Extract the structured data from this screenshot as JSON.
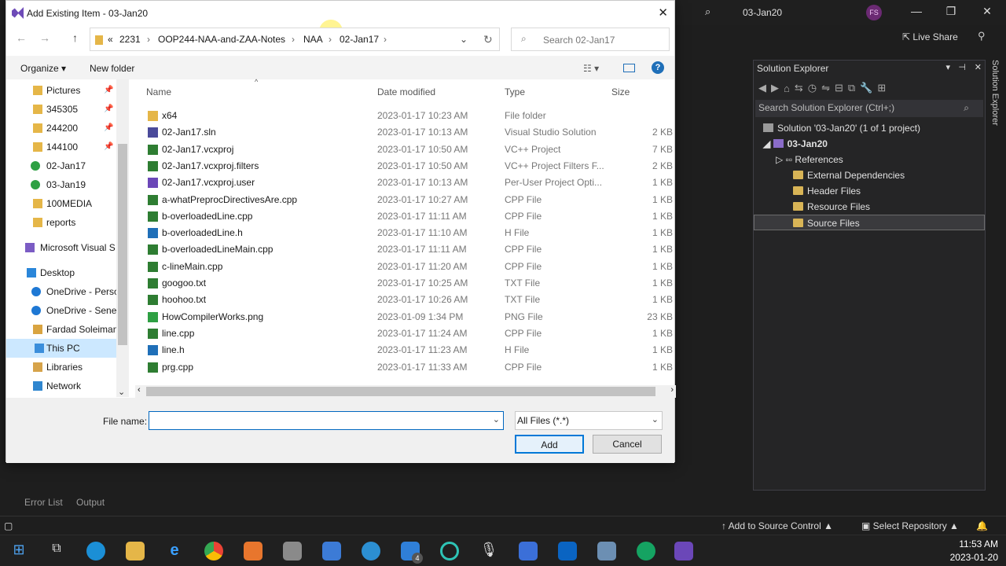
{
  "dialog": {
    "title": "Add Existing Item - 03-Jan20",
    "breadcrumbs": [
      "«",
      "2231",
      "OOP244-NAA-and-ZAA-Notes",
      "NAA",
      "02-Jan17"
    ],
    "search_placeholder": "Search 02-Jan17",
    "organize_label": "Organize ▾",
    "new_folder_label": "New folder",
    "columns": {
      "name": "Name",
      "date": "Date modified",
      "type": "Type",
      "size": "Size"
    },
    "nav_items": [
      {
        "label": "Pictures",
        "pinned": true
      },
      {
        "label": "345305",
        "pinned": true
      },
      {
        "label": "244200",
        "pinned": true
      },
      {
        "label": "144100",
        "pinned": true
      },
      {
        "label": "02-Jan17",
        "pinned": false
      },
      {
        "label": "03-Jan19",
        "pinned": false
      },
      {
        "label": "100MEDIA",
        "pinned": false
      },
      {
        "label": "reports",
        "pinned": false
      },
      {
        "label": "Microsoft Visual S",
        "pinned": false
      },
      {
        "label": "Desktop",
        "pinned": false
      },
      {
        "label": "OneDrive - Perso",
        "pinned": false
      },
      {
        "label": "OneDrive - Sene",
        "pinned": false
      },
      {
        "label": "Fardad Soleiman",
        "pinned": false
      },
      {
        "label": "This PC",
        "pinned": false
      },
      {
        "label": "Libraries",
        "pinned": false
      },
      {
        "label": "Network",
        "pinned": false
      }
    ],
    "files": [
      {
        "name": "x64",
        "date": "2023-01-17 10:23 AM",
        "type": "File folder",
        "size": "",
        "icon": "folder-icon"
      },
      {
        "name": "02-Jan17.sln",
        "date": "2023-01-17 10:13 AM",
        "type": "Visual Studio Solution",
        "size": "2 KB",
        "icon": "solution-file-icon"
      },
      {
        "name": "02-Jan17.vcxproj",
        "date": "2023-01-17 10:50 AM",
        "type": "VC++ Project",
        "size": "7 KB",
        "icon": "project-file-icon"
      },
      {
        "name": "02-Jan17.vcxproj.filters",
        "date": "2023-01-17 10:50 AM",
        "type": "VC++ Project Filters F...",
        "size": "2 KB",
        "icon": "project-file-icon"
      },
      {
        "name": "02-Jan17.vcxproj.user",
        "date": "2023-01-17 10:13 AM",
        "type": "Per-User Project Opti...",
        "size": "1 KB",
        "icon": "user-file-icon"
      },
      {
        "name": "a-whatPreprocDirectivesAre.cpp",
        "date": "2023-01-17 10:27 AM",
        "type": "CPP File",
        "size": "1 KB",
        "icon": "cpp-file-icon"
      },
      {
        "name": "b-overloadedLine.cpp",
        "date": "2023-01-17 11:11 AM",
        "type": "CPP File",
        "size": "1 KB",
        "icon": "cpp-file-icon"
      },
      {
        "name": "b-overloadedLine.h",
        "date": "2023-01-17 11:10 AM",
        "type": "H File",
        "size": "1 KB",
        "icon": "h-file-icon"
      },
      {
        "name": "b-overloadedLineMain.cpp",
        "date": "2023-01-17 11:11 AM",
        "type": "CPP File",
        "size": "1 KB",
        "icon": "cpp-file-icon"
      },
      {
        "name": "c-lineMain.cpp",
        "date": "2023-01-17 11:20 AM",
        "type": "CPP File",
        "size": "1 KB",
        "icon": "cpp-file-icon"
      },
      {
        "name": "googoo.txt",
        "date": "2023-01-17 10:25 AM",
        "type": "TXT File",
        "size": "1 KB",
        "icon": "txt-file-icon"
      },
      {
        "name": "hoohoo.txt",
        "date": "2023-01-17 10:26 AM",
        "type": "TXT File",
        "size": "1 KB",
        "icon": "txt-file-icon"
      },
      {
        "name": "HowCompilerWorks.png",
        "date": "2023-01-09 1:34 PM",
        "type": "PNG File",
        "size": "23 KB",
        "icon": "png-file-icon"
      },
      {
        "name": "line.cpp",
        "date": "2023-01-17 11:24 AM",
        "type": "CPP File",
        "size": "1 KB",
        "icon": "cpp-file-icon"
      },
      {
        "name": "line.h",
        "date": "2023-01-17 11:23 AM",
        "type": "H File",
        "size": "1 KB",
        "icon": "h-file-icon"
      },
      {
        "name": "prg.cpp",
        "date": "2023-01-17 11:33 AM",
        "type": "CPP File",
        "size": "1 KB",
        "icon": "cpp-file-icon"
      }
    ],
    "file_name_label": "File name:",
    "file_name_value": "",
    "file_type_value": "All Files (*.*)",
    "add_label": "Add",
    "cancel_label": "Cancel"
  },
  "vs": {
    "project_title": "03-Jan20",
    "avatar_initials": "FS",
    "live_share_label": "Live Share",
    "solution_explorer": {
      "title": "Solution Explorer",
      "search_placeholder": "Search Solution Explorer (Ctrl+;)",
      "solution_label": "Solution '03-Jan20' (1 of 1 project)",
      "project_label": "03-Jan20",
      "nodes": [
        "References",
        "External Dependencies",
        "Header Files",
        "Resource Files",
        "Source Files"
      ]
    },
    "side_tab": "Solution Explorer",
    "bottom_tabs": [
      "Error List",
      "Output"
    ],
    "status": {
      "source_control": "Add to Source Control ▲",
      "repository": "Select Repository ▲"
    }
  },
  "taskbar": {
    "time": "11:53 AM",
    "date": "2023-01-20",
    "mail_badge": "4"
  }
}
